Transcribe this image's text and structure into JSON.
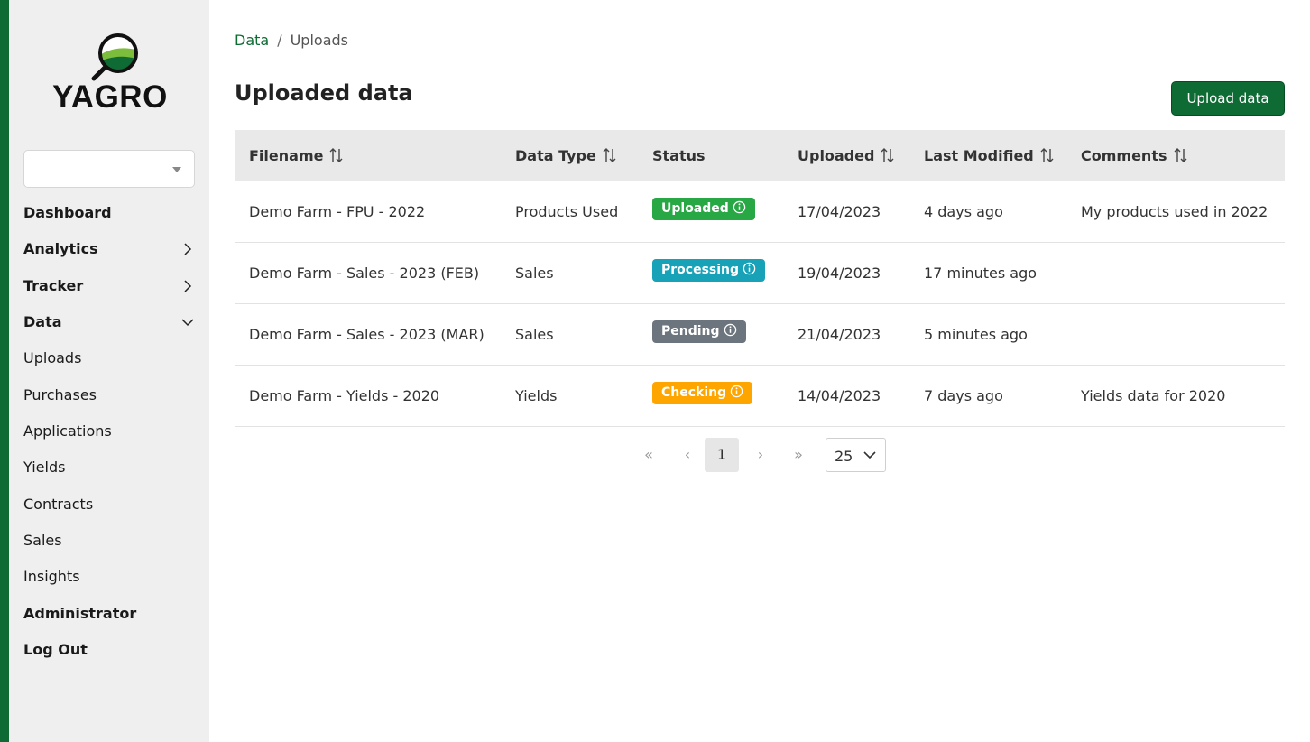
{
  "brand": {
    "name": "YAGRO",
    "color": "#0e6b34"
  },
  "sidebar": {
    "select_value": "",
    "items": [
      {
        "label": "Dashboard",
        "bold": true,
        "chevron": ""
      },
      {
        "label": "Analytics",
        "bold": true,
        "chevron": "right"
      },
      {
        "label": "Tracker",
        "bold": true,
        "chevron": "right"
      },
      {
        "label": "Data",
        "bold": true,
        "chevron": "down"
      },
      {
        "label": "Uploads",
        "bold": false,
        "chevron": ""
      },
      {
        "label": "Purchases",
        "bold": false,
        "chevron": ""
      },
      {
        "label": "Applications",
        "bold": false,
        "chevron": ""
      },
      {
        "label": "Yields",
        "bold": false,
        "chevron": ""
      },
      {
        "label": "Contracts",
        "bold": false,
        "chevron": ""
      },
      {
        "label": "Sales",
        "bold": false,
        "chevron": ""
      },
      {
        "label": "Insights",
        "bold": false,
        "chevron": ""
      },
      {
        "label": "Administrator",
        "bold": true,
        "chevron": ""
      },
      {
        "label": "Log Out",
        "bold": true,
        "chevron": ""
      }
    ]
  },
  "breadcrumb": {
    "parent": "Data",
    "separator": "/",
    "current": "Uploads"
  },
  "page": {
    "title": "Uploaded data",
    "upload_button": "Upload data"
  },
  "table": {
    "columns": [
      "Filename",
      "Data Type",
      "Status",
      "Uploaded",
      "Last Modified",
      "Comments"
    ],
    "rows": [
      {
        "filename": "Demo Farm - FPU - 2022",
        "data_type": "Products Used",
        "status": "Uploaded",
        "status_color": "#28a745",
        "uploaded": "17/04/2023",
        "last_modified": "4 days ago",
        "comments": "My products used in 2022"
      },
      {
        "filename": "Demo Farm - Sales - 2023 (FEB)",
        "data_type": "Sales",
        "status": "Processing",
        "status_color": "#17a2b8",
        "uploaded": "19/04/2023",
        "last_modified": "17 minutes ago",
        "comments": ""
      },
      {
        "filename": "Demo Farm - Sales - 2023 (MAR)",
        "data_type": "Sales",
        "status": "Pending",
        "status_color": "#6c757d",
        "uploaded": "21/04/2023",
        "last_modified": "5 minutes ago",
        "comments": ""
      },
      {
        "filename": "Demo Farm - Yields - 2020",
        "data_type": "Yields",
        "status": "Checking",
        "status_color": "#ffa500",
        "uploaded": "14/04/2023",
        "last_modified": "7 days ago",
        "comments": "Yields data for 2020"
      }
    ]
  },
  "pagination": {
    "first": "«",
    "prev": "‹",
    "current_page": "1",
    "next": "›",
    "last": "»",
    "page_size": "25"
  }
}
